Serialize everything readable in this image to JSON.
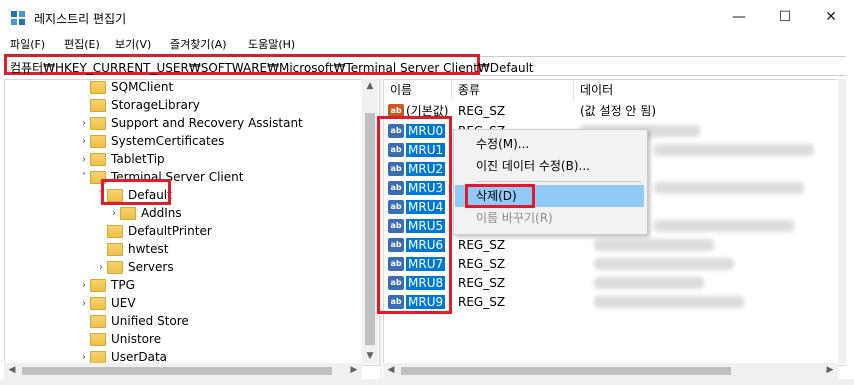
{
  "window": {
    "title": "레지스트리 편집기",
    "controls": {
      "minimize": "—",
      "maximize": "☐",
      "close": "✕"
    }
  },
  "menu": [
    "파일(F)",
    "편집(E)",
    "보기(V)",
    "즐겨찾기(A)",
    "도움말(H)"
  ],
  "address": "컴퓨터₩HKEY_CURRENT_USER₩SOFTWARE₩Microsoft₩Terminal Server Client₩Default",
  "tree": {
    "items": [
      {
        "label": "SQMClient",
        "chev": ""
      },
      {
        "label": "StorageLibrary",
        "chev": ""
      },
      {
        "label": "Support and Recovery Assistant",
        "chev": "›"
      },
      {
        "label": "SystemCertificates",
        "chev": "›"
      },
      {
        "label": "TabletTip",
        "chev": "›"
      },
      {
        "label": "Terminal Server Client",
        "chev": "˅"
      },
      {
        "label": "Default",
        "chev": "˅",
        "selected": true
      },
      {
        "label": "AddIns",
        "chev": "›"
      },
      {
        "label": "DefaultPrinter",
        "chev": ""
      },
      {
        "label": "hwtest",
        "chev": ""
      },
      {
        "label": "Servers",
        "chev": "›"
      },
      {
        "label": "TPG",
        "chev": "›"
      },
      {
        "label": "UEV",
        "chev": "›"
      },
      {
        "label": "Unified Store",
        "chev": ""
      },
      {
        "label": "Unistore",
        "chev": ""
      },
      {
        "label": "UserData",
        "chev": "›"
      }
    ]
  },
  "list": {
    "columns": [
      "이름",
      "종류",
      "데이터"
    ],
    "default_row": {
      "name": "(기본값)",
      "type": "REG_SZ",
      "data": "(값 설정 안 됨)"
    },
    "rows": [
      {
        "name": "MRU0",
        "type": "REG_SZ"
      },
      {
        "name": "MRU1",
        "type": ""
      },
      {
        "name": "MRU2",
        "type": ""
      },
      {
        "name": "MRU3",
        "type": ""
      },
      {
        "name": "MRU4",
        "type": ""
      },
      {
        "name": "MRU5",
        "type": ""
      },
      {
        "name": "MRU6",
        "type": "REG_SZ"
      },
      {
        "name": "MRU7",
        "type": "REG_SZ"
      },
      {
        "name": "MRU8",
        "type": "REG_SZ"
      },
      {
        "name": "MRU9",
        "type": "REG_SZ"
      }
    ]
  },
  "context_menu": {
    "items": [
      "수정(M)...",
      "이진 데이터 수정(B)...",
      "삭제(D)",
      "이름 바꾸기(R)"
    ]
  },
  "colors": {
    "highlight": "#e21b2a",
    "selection": "#0078d7",
    "menu_hover": "#91c9f7"
  },
  "icons": [
    "registry-icon",
    "folder-icon",
    "string-value-icon",
    "chevron-right-icon",
    "chevron-down-icon"
  ]
}
